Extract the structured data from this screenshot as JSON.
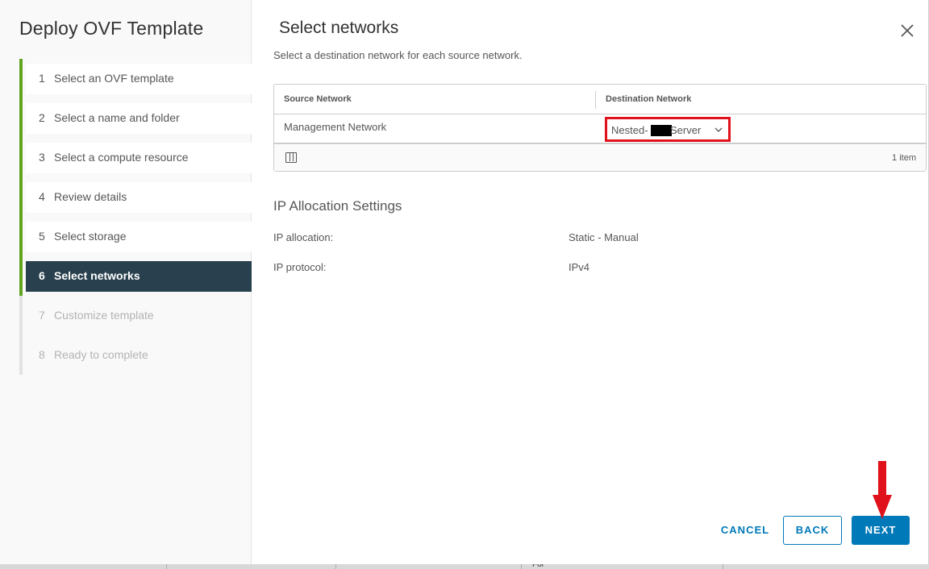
{
  "wizard": {
    "title": "Deploy OVF Template",
    "steps": [
      {
        "num": "1",
        "label": "Select an OVF template",
        "state": "done"
      },
      {
        "num": "2",
        "label": "Select a name and folder",
        "state": "done"
      },
      {
        "num": "3",
        "label": "Select a compute resource",
        "state": "done"
      },
      {
        "num": "4",
        "label": "Review details",
        "state": "done"
      },
      {
        "num": "5",
        "label": "Select storage",
        "state": "done"
      },
      {
        "num": "6",
        "label": "Select networks",
        "state": "active"
      },
      {
        "num": "7",
        "label": "Customize template",
        "state": "pending"
      },
      {
        "num": "8",
        "label": "Ready to complete",
        "state": "pending"
      }
    ]
  },
  "content": {
    "title": "Select networks",
    "subtitle": "Select a destination network for each source network.",
    "grid": {
      "columns": [
        "Source Network",
        "Destination Network"
      ],
      "rows": [
        {
          "source": "Management Network",
          "destination_prefix": "Nested-",
          "destination_suffix": "Server"
        }
      ],
      "footer_count": "1 item"
    },
    "ip_section": {
      "title": "IP Allocation Settings",
      "items": [
        {
          "label": "IP allocation:",
          "value": "Static - Manual"
        },
        {
          "label": "IP protocol:",
          "value": "IPv4"
        }
      ]
    }
  },
  "buttons": {
    "cancel": "CANCEL",
    "back": "BACK",
    "next": "NEXT"
  },
  "colors": {
    "accent": "#0079b8",
    "complete": "#62a420",
    "active_step": "#29414e",
    "highlight": "#e0111b"
  },
  "icons": {
    "close": "close-icon",
    "chevron": "chevron-down-icon",
    "columns": "column-toggle-icon",
    "arrow": "arrow-down-icon"
  },
  "background": {
    "fragment_text": "For"
  }
}
